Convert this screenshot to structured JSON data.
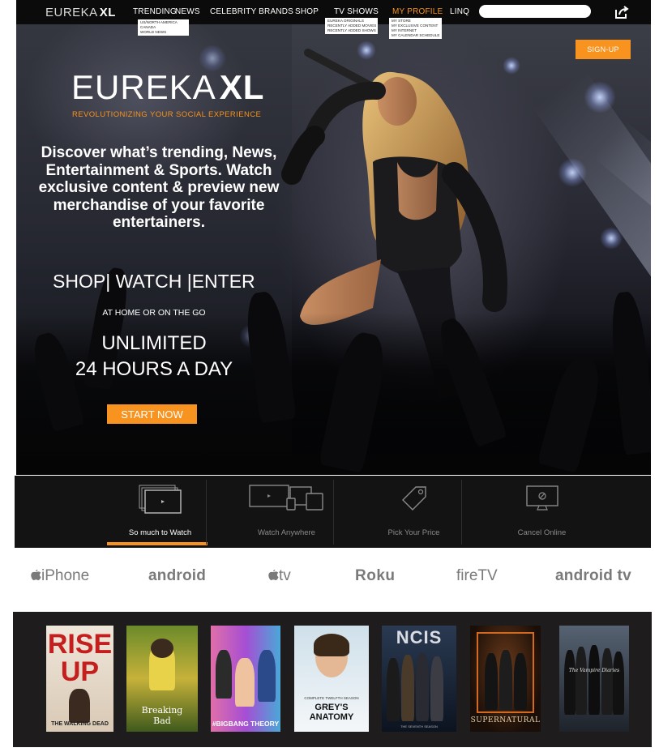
{
  "brand": {
    "name": "EUREKA",
    "suffix": "XL"
  },
  "nav": {
    "items": [
      {
        "label": "TRENDING",
        "active": false
      },
      {
        "label": "NEWS",
        "active": false
      },
      {
        "label": "CELEBRITY BRANDS",
        "active": false
      },
      {
        "label": "SHOP",
        "active": false
      },
      {
        "label": "TV SHOWS",
        "active": false
      },
      {
        "label": "MY PROFILE",
        "active": true
      },
      {
        "label": "LINQ",
        "active": false
      }
    ],
    "news_menu": [
      "US/NORTH AMERICA",
      "CANADA",
      "WORLD NEWS"
    ],
    "tvshows_menu": [
      "EUREKA ORIGINALS",
      "RECENTLY ADDED MOVIES",
      "RECENTLY ADDED SHOWS"
    ],
    "profile_menu": [
      "MY STORE",
      "MY EXCLUSIVE CONTENT",
      "MY INTERNET",
      "MY CALENDAR SCHEDULE"
    ],
    "search_placeholder": ""
  },
  "hero": {
    "signup_label": "SIGN-UP",
    "logo": "EUREKA",
    "logo_suffix": "XL",
    "tagline": "REVOLUTIONIZING YOUR SOCIAL EXPERIENCE",
    "headline": "Discover what’s trending, News, Entertainment & Sports. Watch exclusive content & preview new merchandise of your favorite entertainers.",
    "cta_shop": "SHOP",
    "cta_watch": "WATCH",
    "cta_enter": "ENTER",
    "sub": "AT HOME OR ON THE GO",
    "unlimited_line1": "UNLIMITED",
    "unlimited_line2": "24 HOURS A DAY",
    "start_label": "START NOW"
  },
  "features": [
    {
      "label": "So much to Watch",
      "icon": "screens-icon",
      "active": true
    },
    {
      "label": "Watch Anywhere",
      "icon": "devices-icon",
      "active": false
    },
    {
      "label": "Pick Your Price",
      "icon": "price-tag-icon",
      "active": false
    },
    {
      "label": "Cancel Online",
      "icon": "monitor-cancel-icon",
      "active": false
    }
  ],
  "devices": [
    {
      "label": "iPhone",
      "icon": "apple-icon"
    },
    {
      "label": "android",
      "icon": ""
    },
    {
      "label": "tv",
      "icon": "apple-icon"
    },
    {
      "label": "Roku",
      "icon": ""
    },
    {
      "label": "fireTV",
      "icon": ""
    },
    {
      "label": "android tv",
      "icon": ""
    }
  ],
  "shows": [
    {
      "title": "RISE UP",
      "subtitle": "THE WALKING DEAD"
    },
    {
      "title": "Breaking Bad",
      "subtitle": ""
    },
    {
      "title": "#BIGBANG THEORY",
      "subtitle": ""
    },
    {
      "title": "GREY'S ANATOMY",
      "subtitle": "COMPLETE TWELFTH SEASON"
    },
    {
      "title": "NCIS",
      "subtitle": "THE SEVENTH SEASON"
    },
    {
      "title": "SUPERNATURAL",
      "subtitle": ""
    },
    {
      "title": "The Vampire Diaries",
      "subtitle": ""
    }
  ],
  "colors": {
    "accent": "#f7931e",
    "nav_bg": "#0b0b0b",
    "strip_bg": "#131313",
    "shows_bg": "#1e1c1d"
  }
}
